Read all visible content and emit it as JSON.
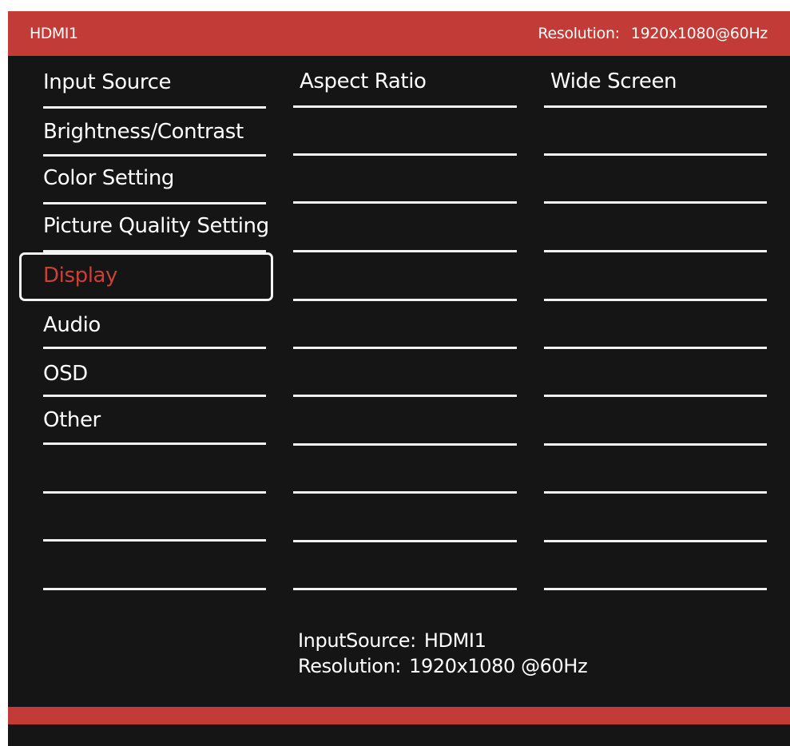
{
  "header": {
    "input_source": "HDMI1",
    "resolution_label": "Resolution:",
    "resolution_value": "1920x1080@60Hz"
  },
  "menu": {
    "items": [
      {
        "label": "Input Source"
      },
      {
        "label": "Brightness/Contrast"
      },
      {
        "label": "Color Setting"
      },
      {
        "label": "Picture Quality Setting"
      },
      {
        "label": "Display",
        "selected": true
      },
      {
        "label": "Audio"
      },
      {
        "label": "OSD"
      },
      {
        "label": "Other"
      },
      {
        "label": ""
      },
      {
        "label": ""
      },
      {
        "label": ""
      }
    ]
  },
  "submenu": {
    "items": [
      {
        "label": "Aspect Ratio"
      },
      {
        "label": ""
      },
      {
        "label": ""
      },
      {
        "label": ""
      },
      {
        "label": ""
      },
      {
        "label": ""
      },
      {
        "label": ""
      },
      {
        "label": ""
      },
      {
        "label": ""
      },
      {
        "label": ""
      },
      {
        "label": ""
      }
    ]
  },
  "values": {
    "items": [
      {
        "label": "Wide Screen"
      },
      {
        "label": ""
      },
      {
        "label": ""
      },
      {
        "label": ""
      },
      {
        "label": ""
      },
      {
        "label": ""
      },
      {
        "label": ""
      },
      {
        "label": ""
      },
      {
        "label": ""
      },
      {
        "label": ""
      },
      {
        "label": ""
      }
    ]
  },
  "info": {
    "input_source_label": "InputSource:",
    "input_source_value": "HDMI1",
    "resolution_label": "Resolution:",
    "resolution_value": "1920x1080 @60Hz"
  },
  "colors": {
    "accent": "#c33b36",
    "background": "#151515",
    "text": "#ffffff",
    "selected_text": "#c94035"
  }
}
